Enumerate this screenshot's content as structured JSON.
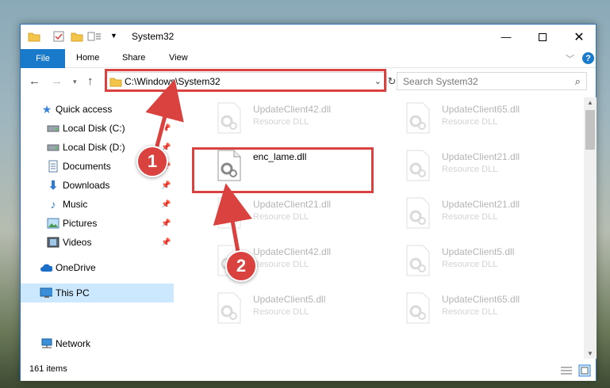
{
  "window": {
    "title": "System32"
  },
  "ribbon": {
    "file": "File",
    "tabs": [
      "Home",
      "Share",
      "View"
    ]
  },
  "nav": {
    "address": "C:\\Windows\\System32",
    "search_placeholder": "Search System32"
  },
  "sidebar": {
    "items": [
      {
        "label": "Quick access",
        "icon": "star-icon"
      },
      {
        "label": "Local Disk (C:)",
        "icon": "drive-icon"
      },
      {
        "label": "Local Disk (D:)",
        "icon": "drive-icon"
      },
      {
        "label": "Documents",
        "icon": "documents-icon"
      },
      {
        "label": "Downloads",
        "icon": "download-icon"
      },
      {
        "label": "Music",
        "icon": "music-icon"
      },
      {
        "label": "Pictures",
        "icon": "pictures-icon"
      },
      {
        "label": "Videos",
        "icon": "videos-icon"
      },
      {
        "label": "OneDrive",
        "icon": "cloud-icon"
      },
      {
        "label": "This PC",
        "icon": "computer-icon"
      },
      {
        "label": "Network",
        "icon": "network-icon"
      }
    ]
  },
  "files": {
    "highlighted": {
      "name": "enc_lame.dll"
    },
    "left": [
      {
        "name": "UpdateClient42.dll",
        "type": "Resource DLL"
      },
      {
        "name": "UpdateClient21.dll",
        "type": "Resource DLL"
      },
      {
        "name": "UpdateClient42.dll",
        "type": "Resource DLL"
      },
      {
        "name": "UpdateClient5.dll",
        "type": "Resource DLL"
      }
    ],
    "right": [
      {
        "name": "UpdateClient65.dll",
        "type": "Resource DLL"
      },
      {
        "name": "UpdateClient21.dll",
        "type": "Resource DLL"
      },
      {
        "name": "UpdateClient21.dll",
        "type": "Resource DLL"
      },
      {
        "name": "UpdateClient5.dll",
        "type": "Resource DLL"
      },
      {
        "name": "UpdateClient65.dll",
        "type": "Resource DLL"
      }
    ]
  },
  "status": {
    "count": "161 items"
  },
  "annotations": {
    "step1": "1",
    "step2": "2"
  },
  "colors": {
    "accent": "#1979ca",
    "highlight": "#d9423f",
    "selected": "#cce8ff"
  }
}
